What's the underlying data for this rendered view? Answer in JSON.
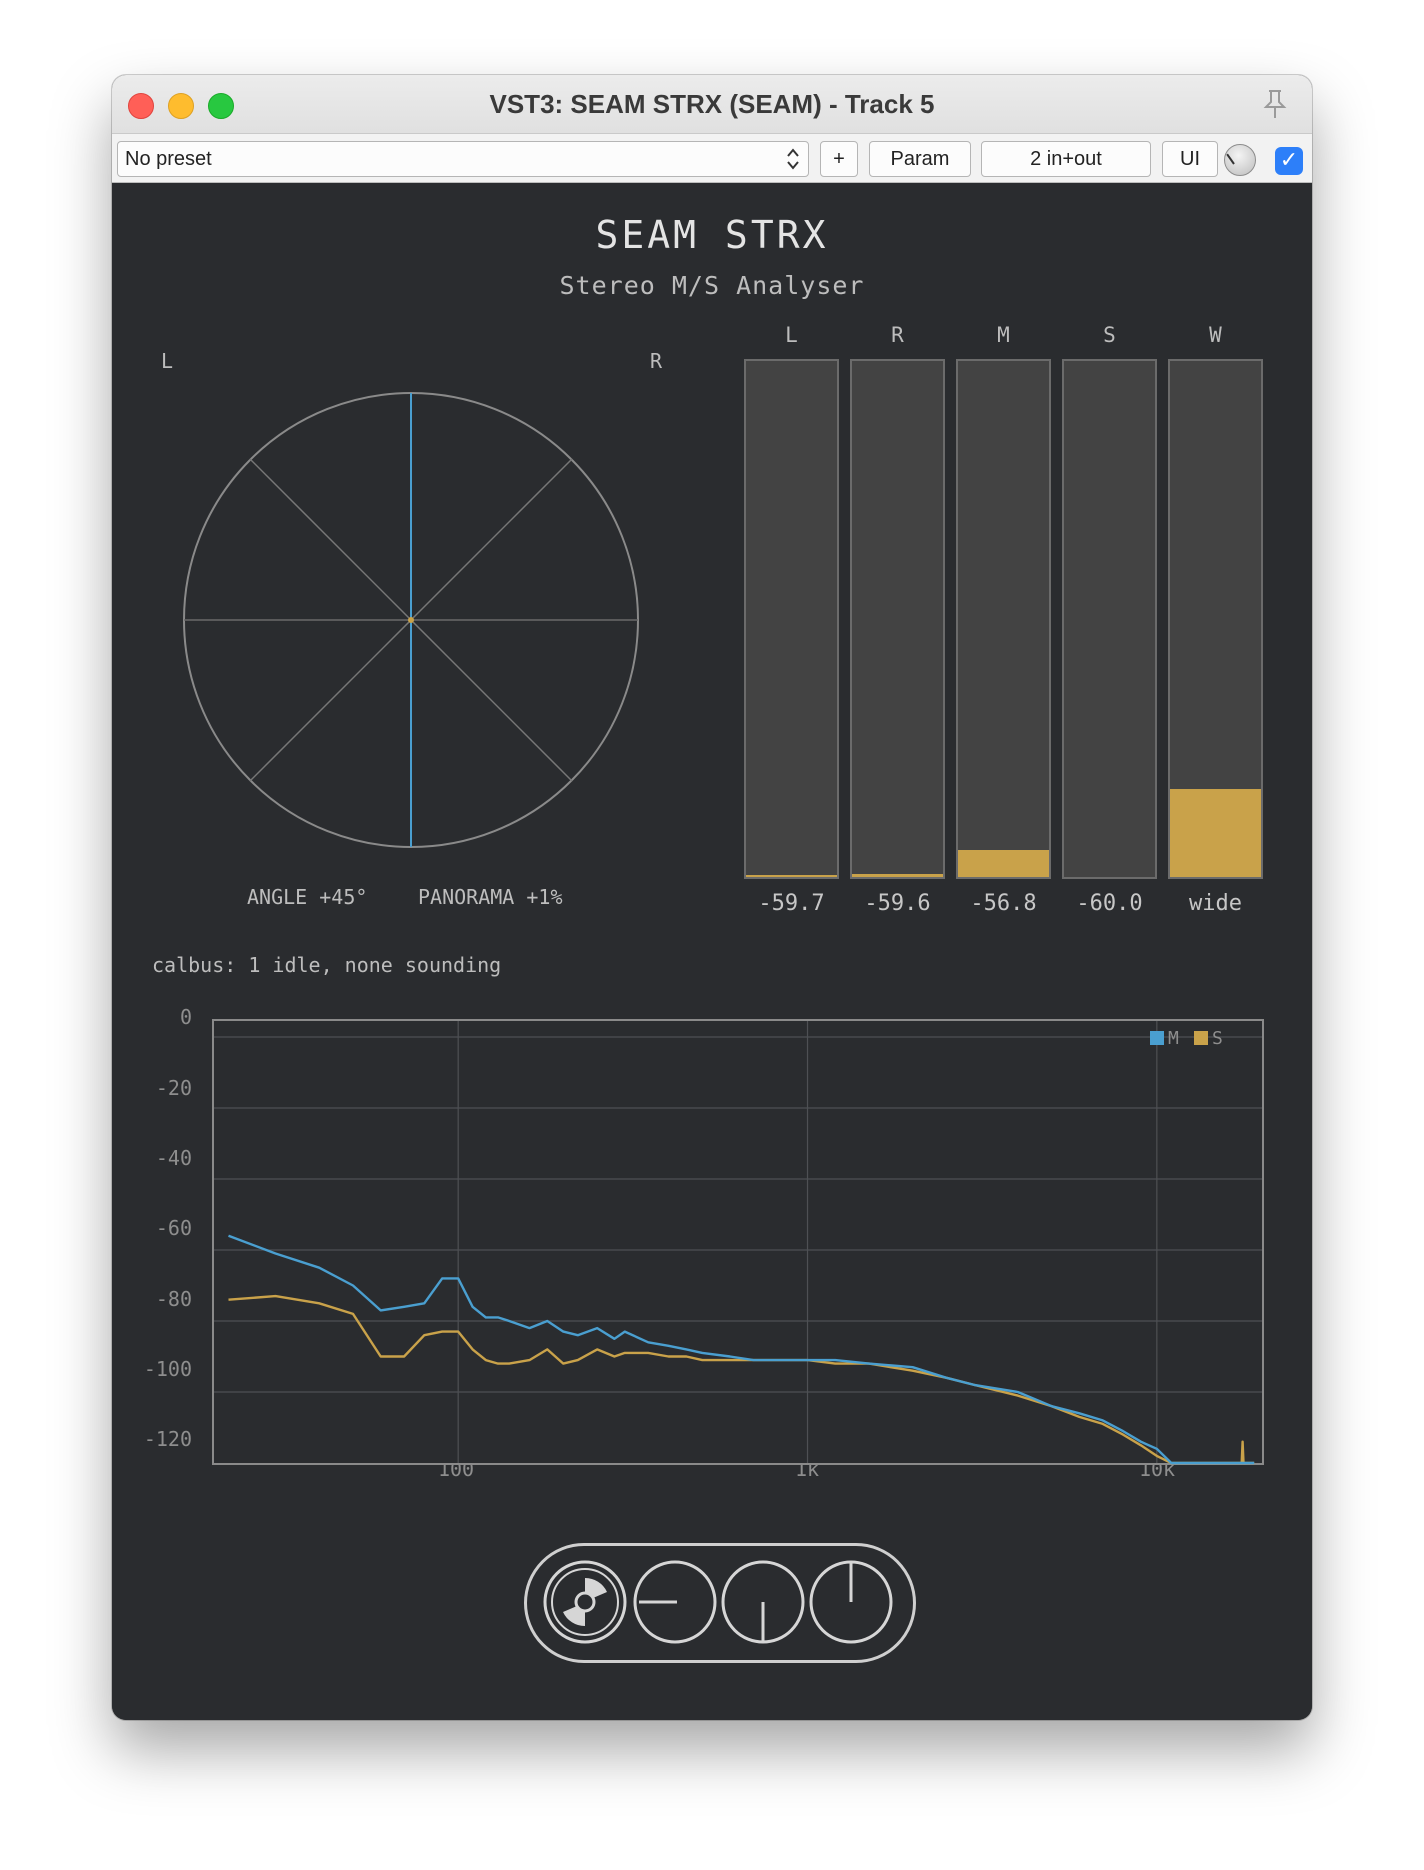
{
  "window": {
    "title": "VST3: SEAM STRX (SEAM) - Track 5"
  },
  "toolbar": {
    "preset": "No preset",
    "plus_label": "+",
    "param_label": "Param",
    "io_label": "2 in+out",
    "ui_label": "UI",
    "enabled": true
  },
  "plugin": {
    "title": "SEAM STRX",
    "subtitle": "Stereo M/S Analyser",
    "vectorscope": {
      "left_label": "L",
      "right_label": "R",
      "angle_text": "ANGLE +45°",
      "panorama_text": "PANORAMA +1%"
    },
    "meters": [
      {
        "label": "L",
        "value": "-59.7",
        "level": 0.004
      },
      {
        "label": "R",
        "value": "-59.6",
        "level": 0.006
      },
      {
        "label": "M",
        "value": "-56.8",
        "level": 0.053
      },
      {
        "label": "S",
        "value": "-60.0",
        "level": 0.0
      },
      {
        "label": "W",
        "value": "wide",
        "level": 0.17
      }
    ],
    "status": "calbus: 1 idle, none sounding"
  },
  "colors": {
    "mid": "#4a9fd0",
    "side": "#c9a24a",
    "accent": "#2d7ff9"
  },
  "chart_data": {
    "type": "line",
    "title": "",
    "xlabel": "",
    "ylabel": "",
    "x_scale": "log",
    "xlim": [
      20,
      20000
    ],
    "ylim": [
      -120,
      0
    ],
    "x_ticks": [
      "100",
      "1k",
      "10k"
    ],
    "y_ticks": [
      "0",
      "-20",
      "-40",
      "-60",
      "-80",
      "-100",
      "-120"
    ],
    "grid": true,
    "legend": "top-right",
    "series": [
      {
        "name": "M",
        "color": "#4a9fd0",
        "x": [
          22,
          30,
          40,
          50,
          60,
          70,
          80,
          90,
          100,
          110,
          120,
          130,
          140,
          160,
          180,
          200,
          220,
          250,
          280,
          300,
          350,
          400,
          450,
          500,
          600,
          700,
          800,
          1000,
          1200,
          1500,
          2000,
          2500,
          3000,
          4000,
          5000,
          6000,
          7000,
          8000,
          9000,
          10000,
          11000,
          15000,
          18000,
          19000
        ],
        "y": [
          -56,
          -61,
          -65,
          -70,
          -77,
          -76,
          -75,
          -68,
          -68,
          -76,
          -79,
          -79,
          -80,
          -82,
          -80,
          -83,
          -84,
          -82,
          -85,
          -83,
          -86,
          -87,
          -88,
          -89,
          -90,
          -91,
          -91,
          -91,
          -91,
          -92,
          -93,
          -96,
          -98,
          -100,
          -104,
          -106,
          -108,
          -111,
          -114,
          -116,
          -120,
          -120,
          -120,
          -120
        ]
      },
      {
        "name": "S",
        "color": "#c9a24a",
        "x": [
          22,
          30,
          40,
          50,
          60,
          70,
          80,
          90,
          100,
          110,
          120,
          130,
          140,
          160,
          180,
          200,
          220,
          250,
          280,
          300,
          350,
          400,
          450,
          500,
          600,
          700,
          800,
          1000,
          1200,
          1500,
          2000,
          2500,
          3000,
          4000,
          5000,
          6000,
          7000,
          8000,
          9000,
          10000,
          11000,
          15000,
          17500,
          17600,
          17700,
          19000
        ],
        "y": [
          -74,
          -73,
          -75,
          -78,
          -90,
          -90,
          -84,
          -83,
          -83,
          -88,
          -91,
          -92,
          -92,
          -91,
          -88,
          -92,
          -91,
          -88,
          -90,
          -89,
          -89,
          -90,
          -90,
          -91,
          -91,
          -91,
          -91,
          -91,
          -92,
          -92,
          -94,
          -96,
          -98,
          -101,
          -104,
          -107,
          -109,
          -112,
          -115,
          -118,
          -120,
          -120,
          -120,
          -114,
          -120,
          -120
        ]
      }
    ]
  },
  "transport": {
    "buttons": [
      "disc-icon",
      "minus-circle-icon",
      "half-circle-icon",
      "power-icon"
    ]
  }
}
